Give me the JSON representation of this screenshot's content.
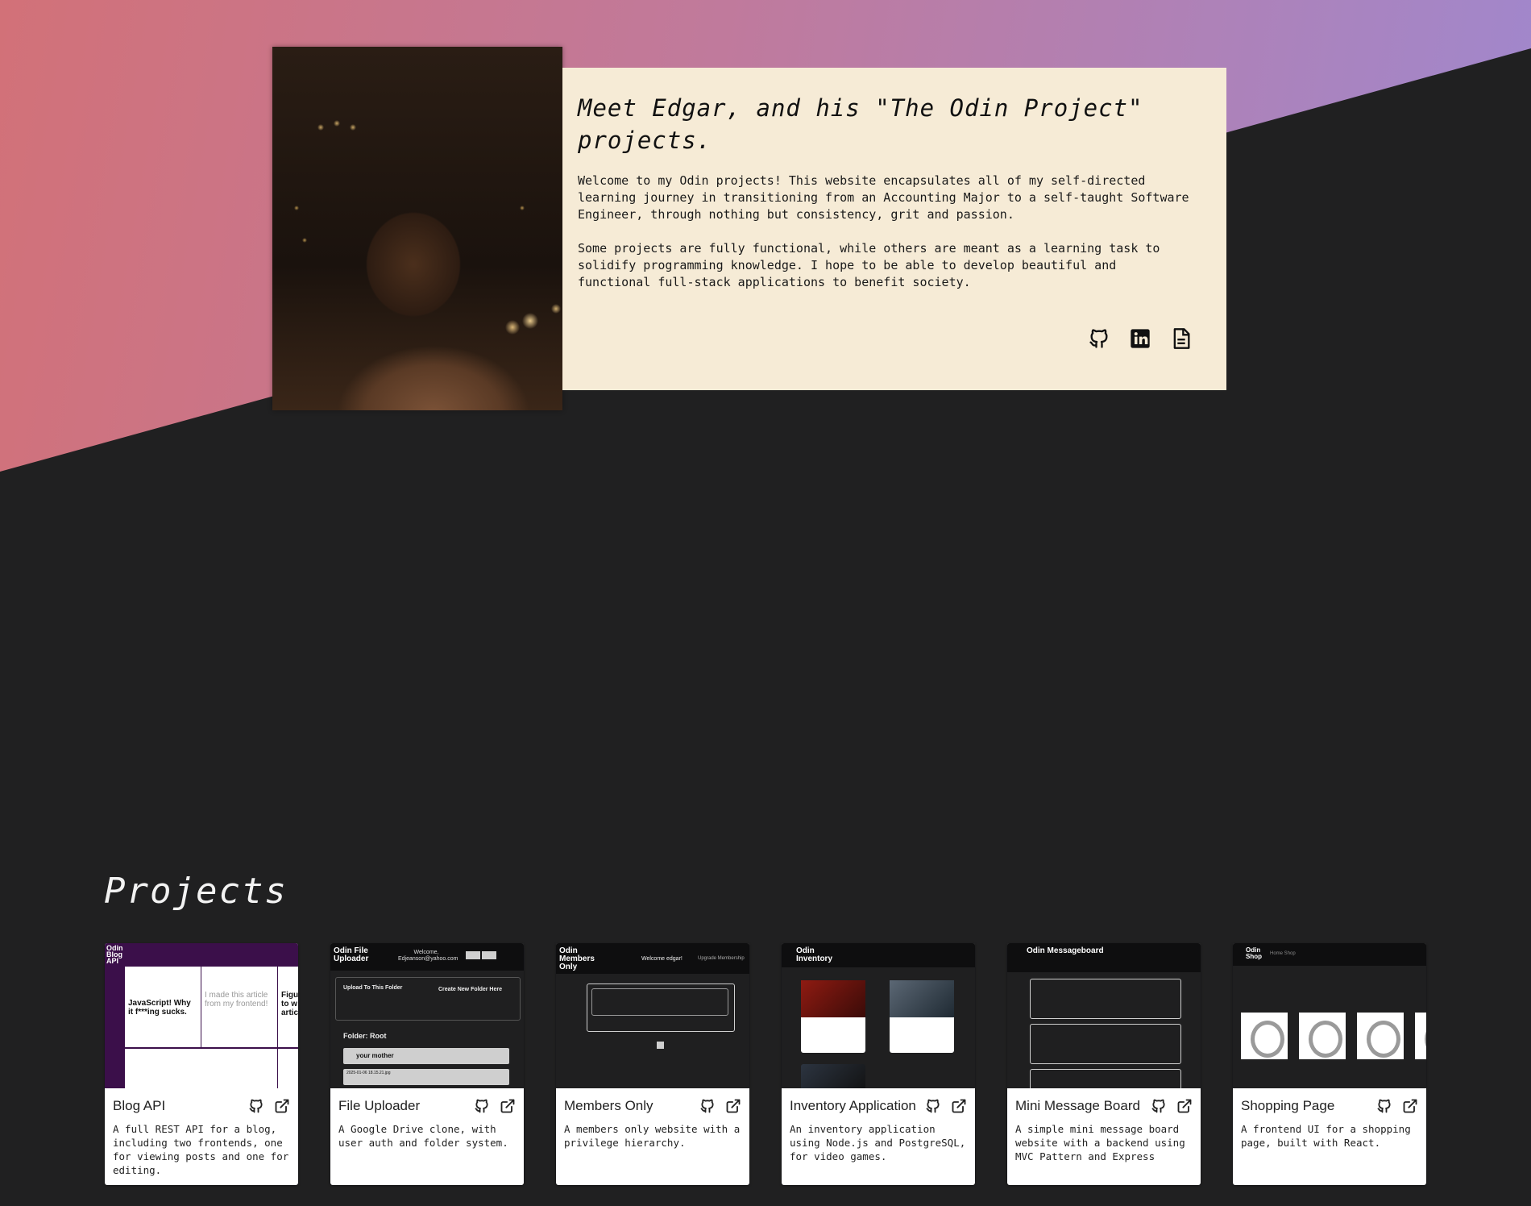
{
  "hero": {
    "title": "Meet Edgar, and his \"The Odin Project\" projects.",
    "paragraph1": "Welcome to my Odin projects! This website encapsulates all of my self-directed learning journey in transitioning from an Accounting Major to a self-taught Software Engineer, through nothing but consistency, grit and passion.",
    "paragraph2": "Some projects are fully functional, while others are meant as a learning task to solidify programming knowledge. I hope to be able to develop beautiful and functional full-stack applications to benefit society.",
    "icons": [
      "github-icon",
      "linkedin-icon",
      "resume-icon"
    ]
  },
  "projects": {
    "heading": "Projects",
    "cards": [
      {
        "title": "Blog API",
        "description": "A full REST API for a blog, including two frontends, one for viewing posts and one for editing."
      },
      {
        "title": "File Uploader",
        "description": "A Google Drive clone, with user auth and folder system."
      },
      {
        "title": "Members Only",
        "description": "A members only website with a privilege hierarchy."
      },
      {
        "title": "Inventory Application",
        "description": "An inventory application using Node.js and PostgreSQL, for video games."
      },
      {
        "title": "Mini Message Board",
        "description": "A simple mini message board website with a backend using MVC Pattern and Express"
      },
      {
        "title": "Shopping Page",
        "description": "A frontend UI for a shopping page, built with React."
      }
    ]
  },
  "thumbnails": {
    "blog": {
      "logo": "Odin Blog API",
      "post1": "JavaScript! Why it f***ing sucks.",
      "post2": "I made this article from my frontend!",
      "post3": "Figu to w artic"
    },
    "uploader": {
      "logo": "Odin File Uploader",
      "welcome": "Welcome, Edjeanson@yahoo.com",
      "upload": "Upload To This Folder",
      "create": "Create New Folder Here",
      "folder": "Folder: Root",
      "item1": "your mother",
      "item2": "2025-01-06 18.15.21.jpg"
    },
    "members": {
      "logo": "Odin Members Only",
      "welcome": "Welcome edgar!",
      "upgrade": "Upgrade Membership"
    },
    "inventory": {
      "logo": "Odin Inventory"
    },
    "messageboard": {
      "logo": "Odin Messageboard"
    },
    "shop": {
      "logo": "Odin Shop",
      "nav": "Home  Shop"
    }
  },
  "colors": {
    "gradient_start": "#d27178",
    "gradient_end": "#9f88cf",
    "background": "#202021",
    "intro_card": "#f6ebd6"
  }
}
